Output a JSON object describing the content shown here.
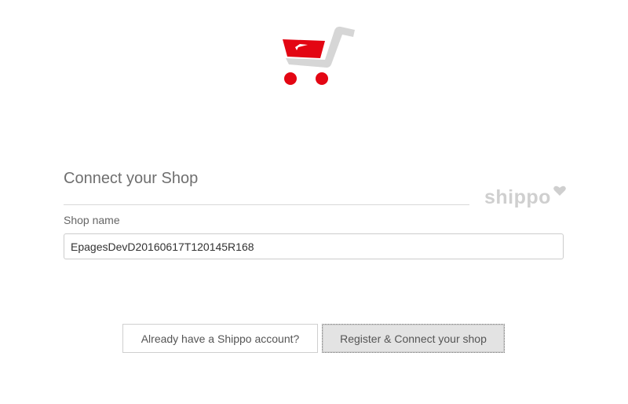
{
  "header": {
    "logo_icon": "shopping-cart-icon",
    "logo_colors": {
      "red": "#e30613",
      "gray": "#d6d6d6"
    }
  },
  "form": {
    "title": "Connect your Shop",
    "brand": "shippo",
    "brand_color": "#cfcfcf",
    "shop_name_label": "Shop name",
    "shop_name_value": "EpagesDevD20160617T120145R168"
  },
  "actions": {
    "existing_account_label": "Already have a Shippo account?",
    "register_label": "Register & Connect your shop"
  }
}
